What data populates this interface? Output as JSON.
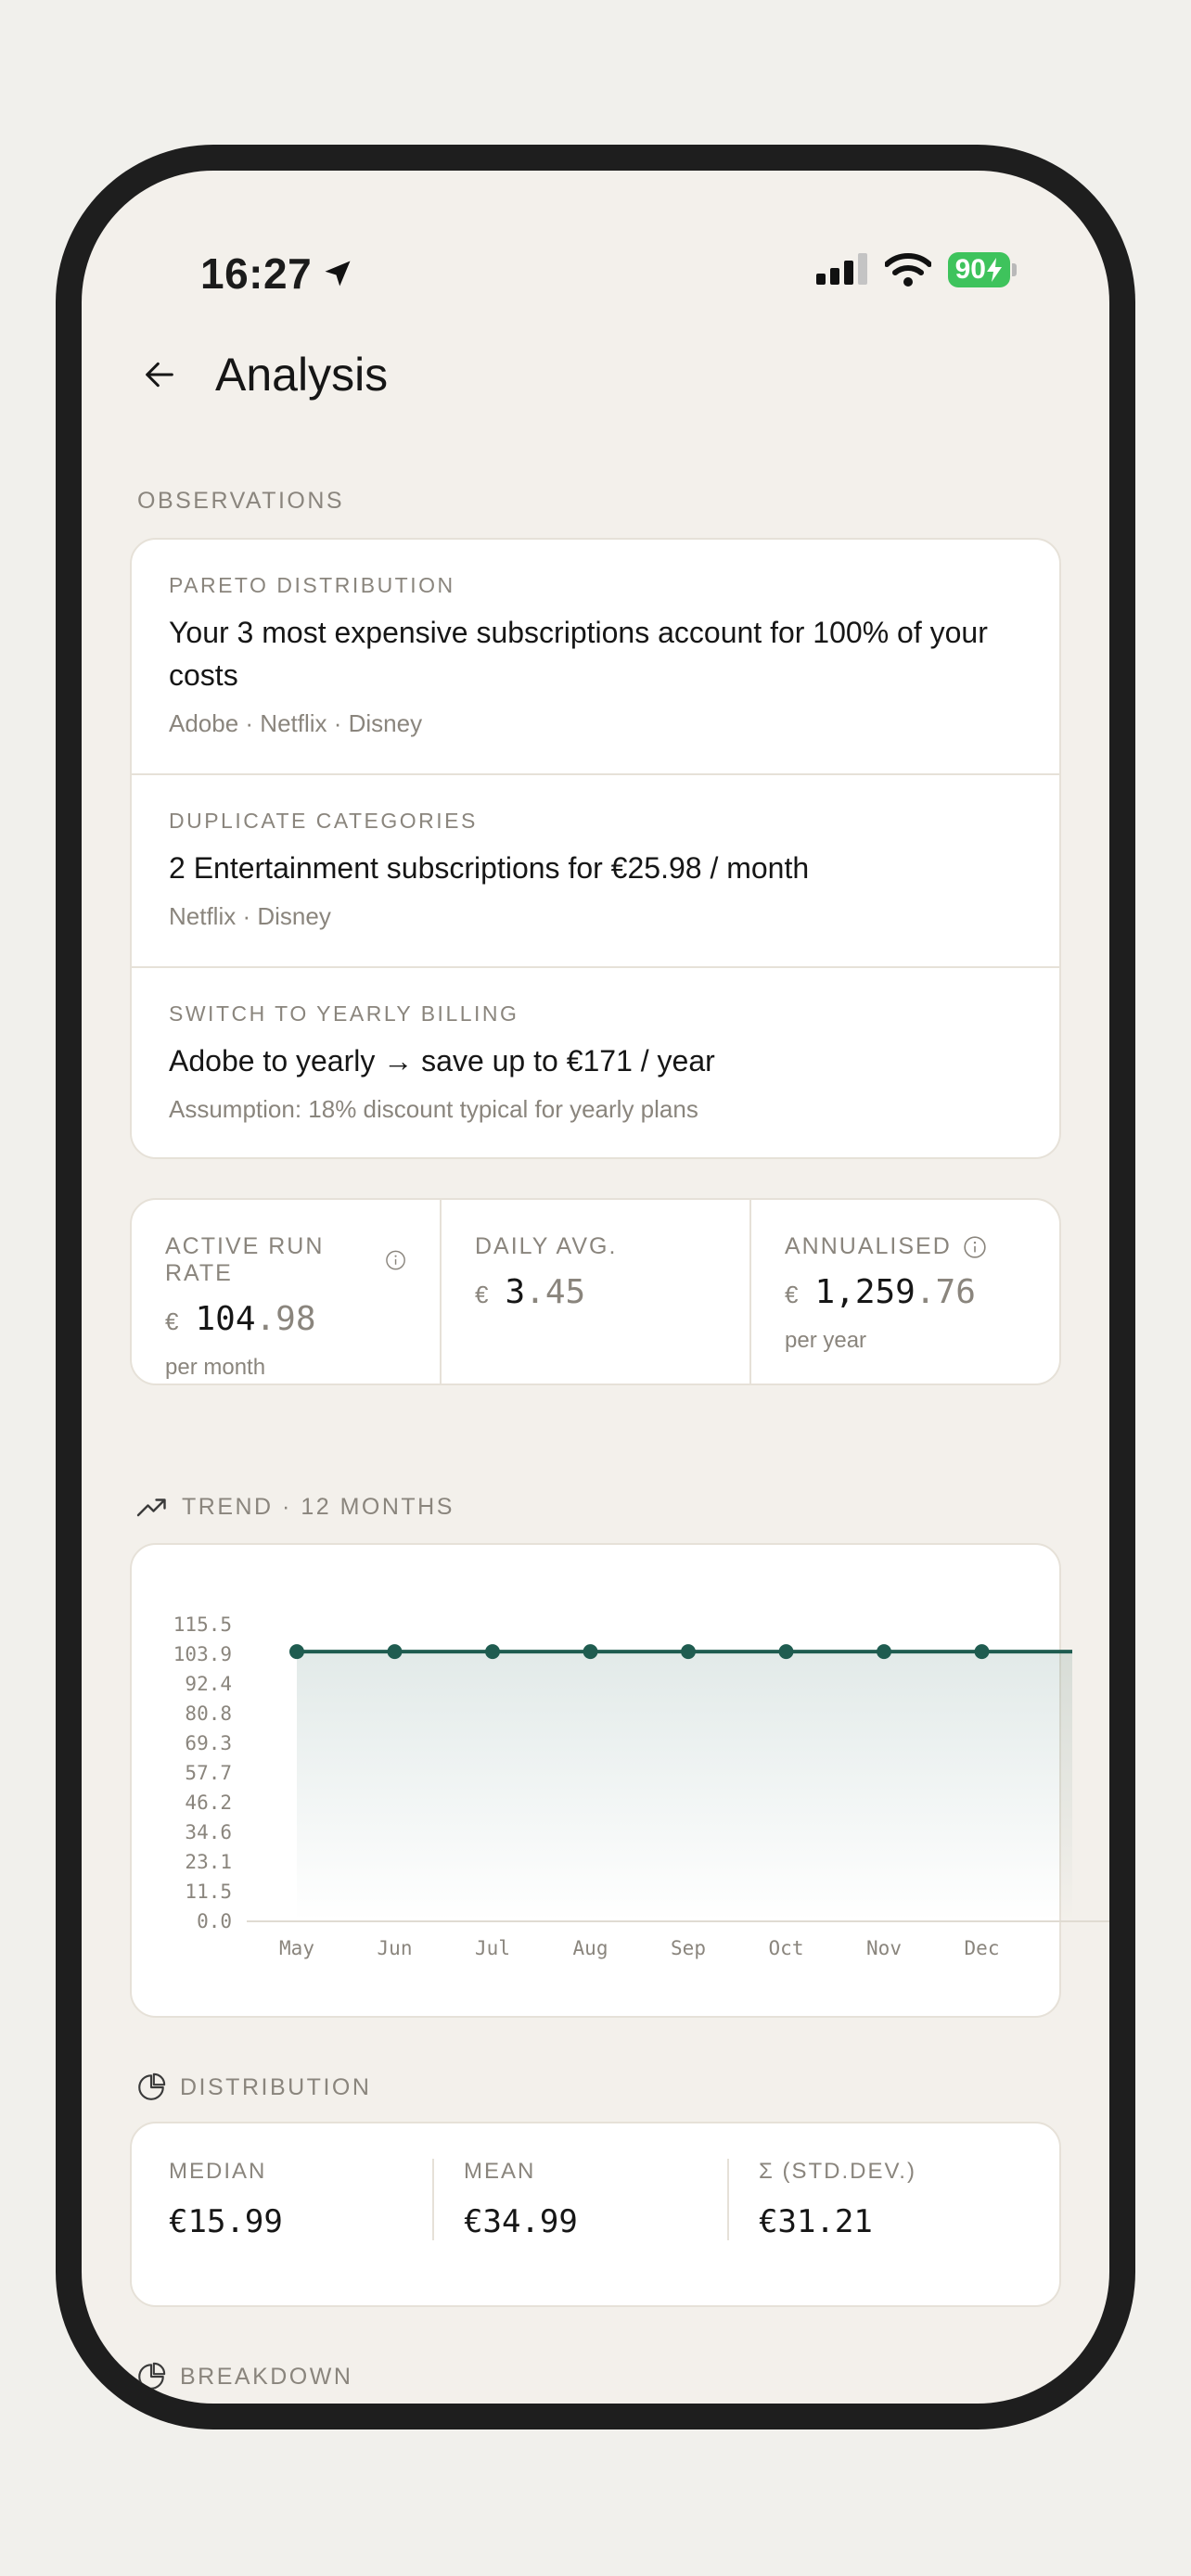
{
  "status_bar": {
    "time": "16:27",
    "battery": "90",
    "icons": [
      "location-arrow-icon",
      "cellular-signal-icon",
      "wifi-icon",
      "battery-charging-icon"
    ]
  },
  "header": {
    "title": "Analysis",
    "back_icon": "arrow-left-icon"
  },
  "observations": {
    "label": "OBSERVATIONS",
    "items": [
      {
        "kicker": "PARETO DISTRIBUTION",
        "title": "Your 3 most expensive subscriptions account for 100% of your costs",
        "sub": "Adobe · Netflix · Disney"
      },
      {
        "kicker": "DUPLICATE CATEGORIES",
        "title": "2 Entertainment subscriptions for €25.98 / month",
        "sub": "Netflix · Disney"
      },
      {
        "kicker": "SWITCH TO YEARLY BILLING",
        "title": "Adobe to yearly → save up to €171 / year",
        "sub": "Assumption: 18% discount typical for yearly plans"
      }
    ]
  },
  "metrics": [
    {
      "label": "ACTIVE RUN RATE",
      "currency": "€",
      "int": "104",
      "dec": ".98",
      "sub": "per month",
      "info": true
    },
    {
      "label": "DAILY AVG.",
      "currency": "€",
      "int": "3",
      "dec": ".45",
      "sub": "",
      "info": false
    },
    {
      "label": "ANNUALISED",
      "currency": "€",
      "int": "1,259",
      "dec": ".76",
      "sub": "per year",
      "info": true
    }
  ],
  "trend": {
    "label": "TREND · 12 MONTHS",
    "icon": "trending-up-icon"
  },
  "chart_data": {
    "type": "area",
    "categories": [
      "May",
      "Jun",
      "Jul",
      "Aug",
      "Sep",
      "Oct",
      "Nov",
      "Dec"
    ],
    "values": [
      104.98,
      104.98,
      104.98,
      104.98,
      104.98,
      104.98,
      104.98,
      104.98
    ],
    "y_ticks": [
      "115.5",
      "103.9",
      "92.4",
      "80.8",
      "69.3",
      "57.7",
      "46.2",
      "34.6",
      "23.1",
      "11.5",
      "0.0"
    ],
    "ylim": [
      0,
      115.5
    ],
    "line_color": "#1f5c50",
    "grid": false
  },
  "distribution": {
    "label": "DISTRIBUTION",
    "icon": "pie-chart-icon",
    "stats": [
      {
        "label": "MEDIAN",
        "value": "€15.99"
      },
      {
        "label": "MEAN",
        "value": "€34.99"
      },
      {
        "label": "Σ (STD.DEV.)",
        "value": "€31.21"
      }
    ]
  },
  "breakdown": {
    "label": "BREAKDOWN",
    "icon": "pie-chart-icon"
  },
  "colors": {
    "background": "#f3f0eb",
    "card": "#ffffff",
    "muted": "#8a857d",
    "accent": "#1f5c50",
    "battery": "#3ec35c"
  }
}
